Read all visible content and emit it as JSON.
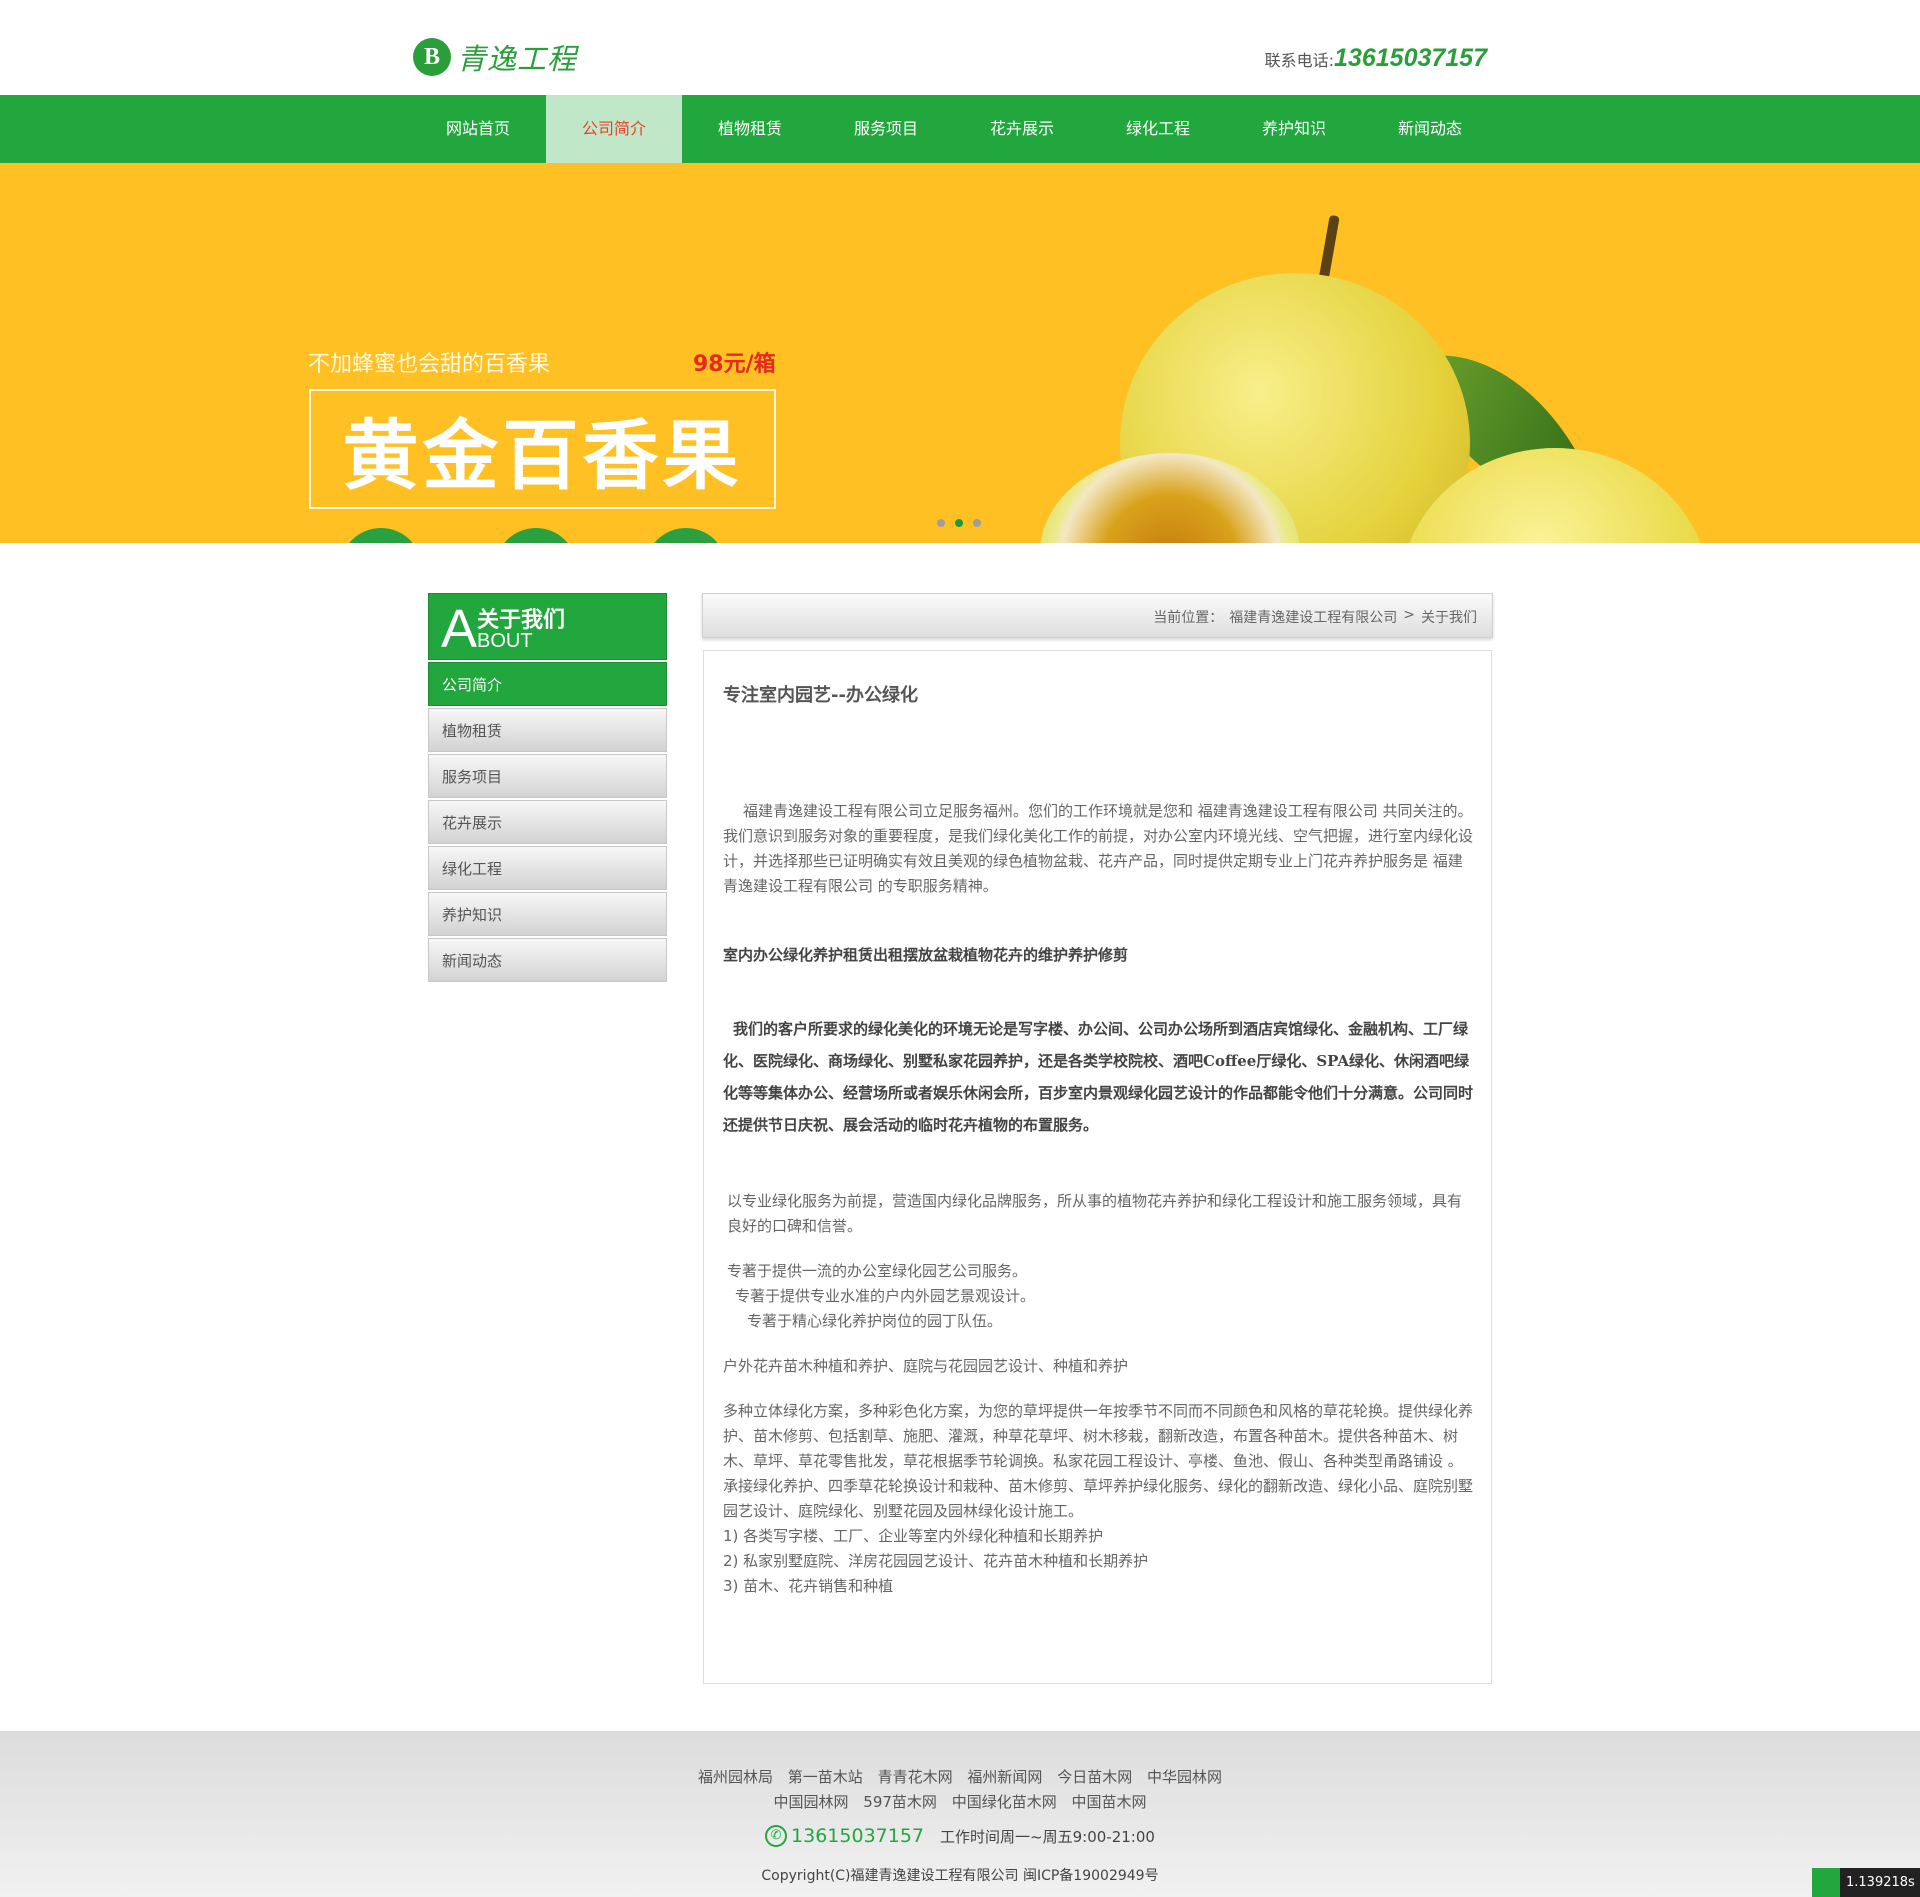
{
  "header": {
    "logo_mark": "B",
    "logo_text": "青逸工程",
    "phone_label": "联系电话:",
    "phone": "13615037157"
  },
  "nav": {
    "items": [
      {
        "label": "网站首页"
      },
      {
        "label": "公司简介"
      },
      {
        "label": "植物租赁"
      },
      {
        "label": "服务项目"
      },
      {
        "label": "花卉展示"
      },
      {
        "label": "绿化工程"
      },
      {
        "label": "养护知识"
      },
      {
        "label": "新闻动态"
      }
    ],
    "active_index": 1,
    "bg_color": "#21a73d",
    "active_color": "#e8432a"
  },
  "banner": {
    "tagline": "不加蜂蜜也会甜的百香果",
    "price": "98元/箱",
    "title": "黄金百香果",
    "slides": 3,
    "active_slide": 2,
    "bg_color": "#fec023"
  },
  "sidebar": {
    "heading_letter": "A",
    "heading_cn": "关于我们",
    "heading_en": "BOUT",
    "items": [
      {
        "label": "公司简介"
      },
      {
        "label": "植物租赁"
      },
      {
        "label": "服务项目"
      },
      {
        "label": "花卉展示"
      },
      {
        "label": "绿化工程"
      },
      {
        "label": "养护知识"
      },
      {
        "label": "新闻动态"
      }
    ],
    "active_index": 0
  },
  "breadcrumb": {
    "label": "当前位置：",
    "home": "福建青逸建设工程有限公司",
    "sep": ">",
    "current": "关于我们"
  },
  "content": {
    "title": "专注室内园艺--办公绿化",
    "p1": "福建青逸建设工程有限公司立足服务福州。您们的工作环境就是您和 福建青逸建设工程有限公司 共同关注的。我们意识到服务对象的重要程度，是我们绿化美化工作的前提，对办公室内环境光线、空气把握，进行室内绿化设计，并选择那些已证明确实有效且美观的绿色植物盆栽、花卉产品，同时提供定期专业上门花卉养护服务是 福建青逸建设工程有限公司 的专职服务精神。",
    "subhead": "室内办公绿化养护租赁出租摆放盆栽植物花卉的维护养护修剪",
    "p2": "我们的客户所要求的绿化美化的环境无论是写字楼、办公间、公司办公场所到酒店宾馆绿化、金融机构、工厂绿化、医院绿化、商场绿化、别墅私家花园养护，还是各类学校院校、酒吧Coffee厅绿化、SPA绿化、休闲酒吧绿化等等集体办公、经营场所或者娱乐休闲会所，百步室内景观绿化园艺设计的作品都能令他们十分满意。公司同时还提供节日庆祝、展会活动的临时花卉植物的布置服务。",
    "p3": "以专业绿化服务为前提，营造国内绿化品牌服务，所从事的植物花卉养护和绿化工程设计和施工服务领域，具有良好的口碑和信誉。",
    "p4_lines": [
      "专著于提供一流的办公室绿化园艺公司服务。",
      "专著于提供专业水准的户内外园艺景观设计。",
      "专著于精心绿化养护岗位的园丁队伍。"
    ],
    "p5": "户外花卉苗木种植和养护、庭院与花园园艺设计、种植和养护",
    "p6": "多种立体绿化方案，多种彩色化方案，为您的草坪提供一年按季节不同而不同颜色和风格的草花轮换。提供绿化养护、苗木修剪、包括割草、施肥、灌溉，种草花草坪、树木移栽，翻新改造，布置各种苗木。提供各种苗木、树木、草坪、草花零售批发，草花根据季节轮调换。私家花园工程设计、亭楼、鱼池、假山、各种类型甬路铺设 。承接绿化养护、四季草花轮换设计和栽种、苗木修剪、草坪养护绿化服务、绿化的翻新改造、绿化小品、庭院别墅园艺设计、庭院绿化、别墅花园及园林绿化设计施工。",
    "list": [
      "1) 各类写字楼、工厂、企业等室内外绿化种植和长期养护",
      "2) 私家别墅庭院、洋房花园园艺设计、花卉苗木种植和长期养护",
      "3) 苗木、花卉销售和种植"
    ]
  },
  "footer": {
    "links_row1": [
      "福州园林局",
      "第一苗木站",
      "青青花木网",
      "福州新闻网",
      "今日苗木网",
      "中华园林网"
    ],
    "links_row2": [
      "中国园林网",
      "597苗木网",
      "中国绿化苗木网",
      "中国苗木网"
    ],
    "phone": "13615037157",
    "hours": "工作时间周一~周五9:00-21:00",
    "copyright": "Copyright(C)福建青逸建设工程有限公司 闽ICP备19002949号"
  },
  "timer": {
    "value": "1.139218s"
  }
}
